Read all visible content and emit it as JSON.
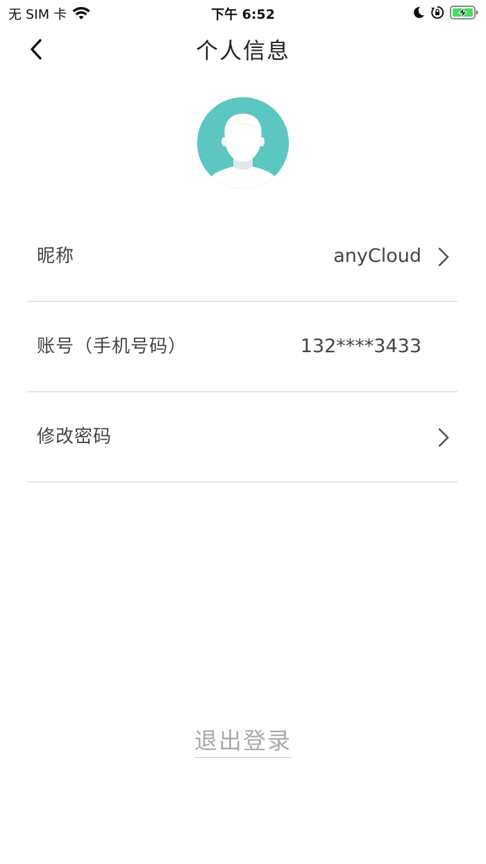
{
  "status_bar": {
    "carrier": "无 SIM 卡",
    "time": "下午 6:52"
  },
  "nav": {
    "title": "个人信息",
    "back_icon": "chevron-left-icon"
  },
  "avatar": {
    "icon": "default-user-avatar-icon"
  },
  "rows": [
    {
      "label": "昵称",
      "value": "anyCloud",
      "has_chevron": true
    },
    {
      "label": "账号（手机号码）",
      "value": "132****3433",
      "has_chevron": false
    },
    {
      "label": "修改密码",
      "value": "",
      "has_chevron": true
    }
  ],
  "logout": {
    "label": "退出登录"
  },
  "colors": {
    "avatar_bg": "#5cc6c1",
    "divider": "#e6e6e6",
    "logout_text": "#aaaaaa",
    "battery_fill": "#4cd964"
  }
}
